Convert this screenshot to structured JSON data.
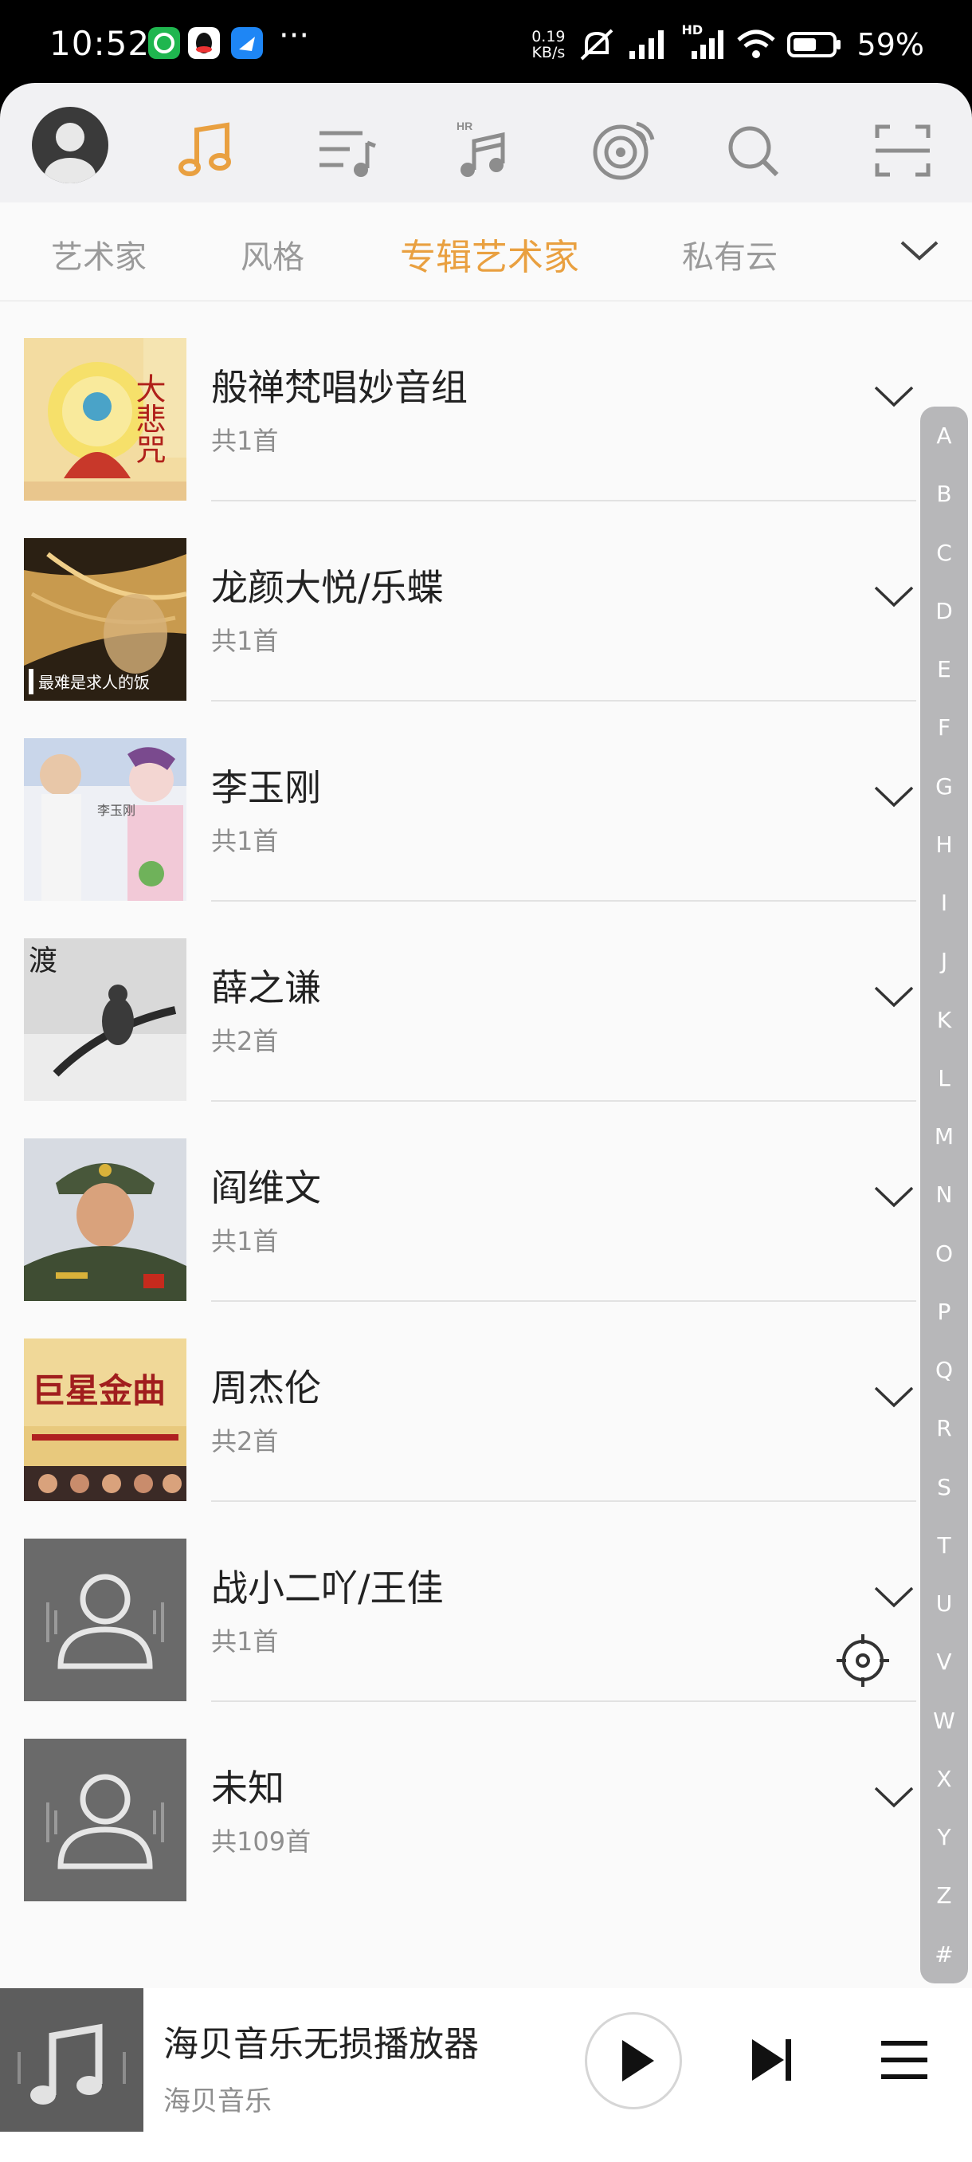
{
  "status_bar": {
    "time": "10:52",
    "more": "···",
    "net_speed_value": "0.19",
    "net_speed_unit": "KB/s",
    "battery": "59%",
    "hd_label": "HD"
  },
  "top_nav": {
    "hr_label": "HR",
    "accent_color": "#e9a040",
    "icons": [
      "profile-avatar",
      "music-note-icon",
      "playlist-icon",
      "hr-music-icon",
      "radio-disc-icon",
      "search-icon",
      "scan-icon"
    ]
  },
  "tabs": [
    {
      "label": "艺术家",
      "active": false
    },
    {
      "label": "风格",
      "active": false
    },
    {
      "label": "专辑艺术家",
      "active": true
    },
    {
      "label": "私有云",
      "active": false
    }
  ],
  "artists": [
    {
      "name": "般禅梵唱妙音组",
      "count": "共1首",
      "cover_text": "大悲咒"
    },
    {
      "name": "龙颜大悦/乐蝶",
      "count": "共1首",
      "cover_text": "最难是求人的饭"
    },
    {
      "name": "李玉刚",
      "count": "共1首",
      "cover_text": "李玉刚"
    },
    {
      "name": "薛之谦",
      "count": "共2首",
      "cover_text": "渡"
    },
    {
      "name": "阎维文",
      "count": "共1首",
      "cover_text": ""
    },
    {
      "name": "周杰伦",
      "count": "共2首",
      "cover_text": "巨星金曲"
    },
    {
      "name": "战小二吖/王佳",
      "count": "共1首",
      "cover_text": ""
    },
    {
      "name": "未知",
      "count": "共109首",
      "cover_text": ""
    }
  ],
  "az_index": [
    "A",
    "B",
    "C",
    "D",
    "E",
    "F",
    "G",
    "H",
    "I",
    "J",
    "K",
    "L",
    "M",
    "N",
    "O",
    "P",
    "Q",
    "R",
    "S",
    "T",
    "U",
    "V",
    "W",
    "X",
    "Y",
    "Z",
    "#"
  ],
  "player": {
    "title": "海贝音乐无损播放器",
    "artist": "海贝音乐"
  }
}
